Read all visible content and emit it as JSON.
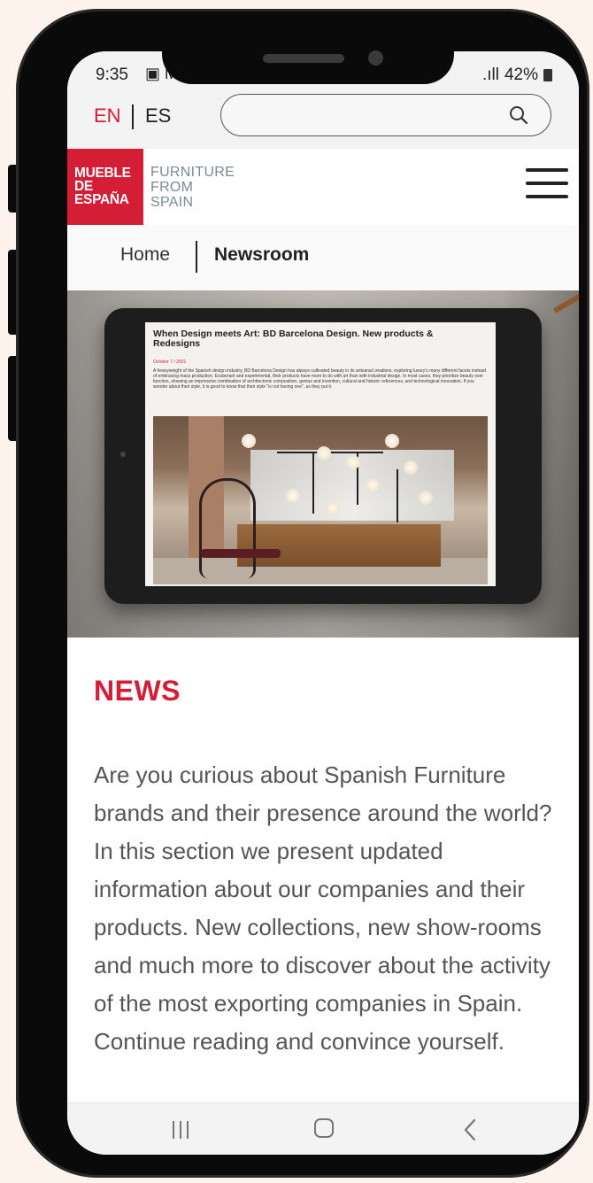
{
  "status_bar": {
    "time": "9:35",
    "left_icons": "▣ M",
    "signal": ".ıll",
    "battery": "42%"
  },
  "language": {
    "active": "EN",
    "other": "ES"
  },
  "search": {
    "value": "",
    "placeholder": ""
  },
  "logo": {
    "badge_lines": [
      "MUEBLE",
      "DE",
      "ESPAÑA"
    ],
    "text_lines": [
      "FURNITURE",
      "FROM",
      "SPAIN"
    ]
  },
  "breadcrumb": {
    "home": "Home",
    "current": "Newsroom"
  },
  "hero_article": {
    "title": "When Design meets Art: BD Barcelona Design. New products & Redesigns",
    "date": "October 7 / 2021",
    "text": "A heavyweight of the Spanish design industry, BD Barcelona Design has always cultivated beauty in its artisanal creations, exploring luxury's many different facets instead of embracing mass production. Exuberant and experimental, their products have more to do with art than with industrial design. In most cases, they prioritize beauty over function, showing an impressive combination of architectonic composition, genius and invention, cultural and historic references, and technological innovation. If you wonder about their style, it is good to know that their style \"is not having one\", as they put it."
  },
  "news": {
    "title": "NEWS",
    "body": "Are you curious about Spanish Furniture brands and their presence around the world? In this section we present updated information about our companies and their products. New collections, new show-rooms and much more to discover about the activity of the most exporting companies in Spain. Continue reading and convince yourself."
  },
  "colors": {
    "brand_red": "#d41e36",
    "logo_grey": "#7a8a96",
    "phone_frame": "#0a0a0a",
    "background": "#fdf3ec"
  },
  "icons": {
    "search": "search-icon",
    "menu": "hamburger-menu-icon",
    "nav_recent": "recent-apps-icon",
    "nav_home": "home-icon",
    "nav_back": "back-icon"
  }
}
